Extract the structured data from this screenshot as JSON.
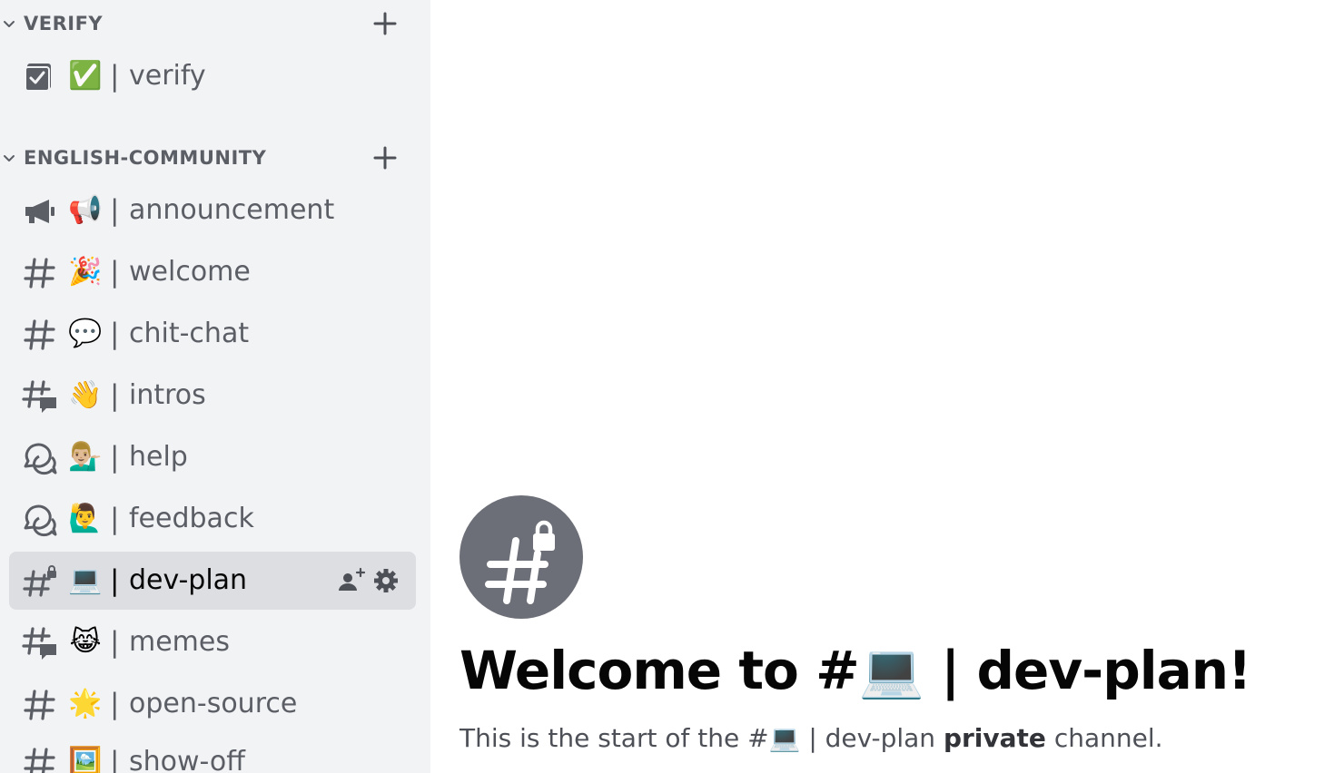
{
  "sidebar": {
    "categories": [
      {
        "name": "VERIFY",
        "collapse_icon": "chevron-down-icon",
        "add_icon": "plus-icon"
      },
      {
        "name": "ENGLISH-COMMUNITY",
        "collapse_icon": "chevron-down-icon",
        "add_icon": "plus-icon"
      }
    ],
    "channels": [
      {
        "icon": "rules-channel-icon",
        "emoji": "✅",
        "separator": "|",
        "name": "verify"
      },
      {
        "icon": "announcement-channel-icon",
        "emoji": "📢",
        "separator": "|",
        "name": "announcement"
      },
      {
        "icon": "text-channel-icon",
        "emoji": "🎉",
        "separator": "|",
        "name": "welcome"
      },
      {
        "icon": "text-channel-icon",
        "emoji": "💬",
        "separator": "|",
        "name": "chit-chat"
      },
      {
        "icon": "thread-channel-icon",
        "emoji": "👋",
        "separator": "|",
        "name": "intros"
      },
      {
        "icon": "forum-channel-icon",
        "emoji": "💁🏼‍♂️",
        "separator": "|",
        "name": "help"
      },
      {
        "icon": "forum-channel-icon",
        "emoji": "🙋‍♂️",
        "separator": "|",
        "name": "feedback"
      },
      {
        "icon": "private-text-channel-icon",
        "emoji": "💻",
        "separator": "|",
        "name": "dev-plan",
        "active": true,
        "actions": [
          "invite-user-icon",
          "gear-icon"
        ]
      },
      {
        "icon": "thread-channel-icon",
        "emoji": "😹",
        "separator": "|",
        "name": "memes"
      },
      {
        "icon": "text-channel-icon",
        "emoji": "🌟",
        "separator": "|",
        "name": "open-source"
      },
      {
        "icon": "text-channel-icon",
        "emoji": "🖼️",
        "separator": "|",
        "name": "show-off"
      }
    ]
  },
  "main": {
    "welcome_icon": "private-channel-hash-icon",
    "welcome_title": "Welcome to #💻 | dev-plan!",
    "welcome_sub_prefix": "This is the start of the #💻 | dev-plan ",
    "welcome_sub_bold": "private",
    "welcome_sub_suffix": " channel."
  },
  "colors": {
    "sidebar_bg": "#f2f3f5",
    "active_bg": "#dcdee2",
    "muted_text": "#5c5e66",
    "active_text": "#060607",
    "avatar_bg": "#6d6f78"
  }
}
